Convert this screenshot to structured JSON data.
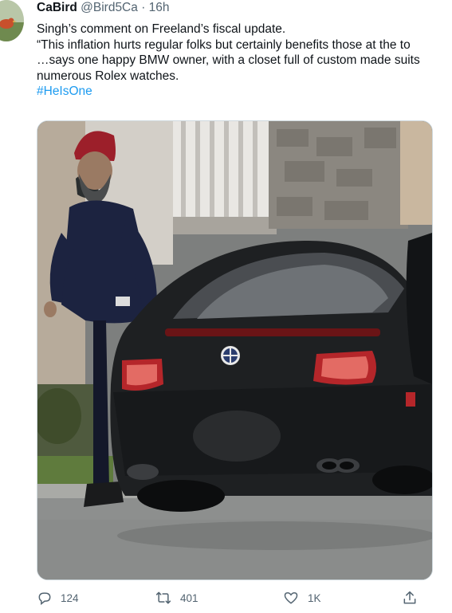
{
  "tweet": {
    "display_name": "CaBird",
    "handle": "@Bird5Ca",
    "separator": "·",
    "time": "16h",
    "lines": [
      "Singh’s comment on Freeland’s fiscal update.",
      "“This inflation hurts regular folks but certainly benefits those at the to",
      "…says one happy BMW owner, with a closet full of custom made suits",
      "numerous Rolex watches."
    ],
    "hashtag": "#HeIsOne"
  },
  "actions": {
    "reply_count": "124",
    "retweet_count": "401",
    "like_count": "1K"
  },
  "colors": {
    "text": "#0f1419",
    "muted": "#536471",
    "link": "#1d9bf0"
  },
  "icons": [
    "reply-icon",
    "retweet-icon",
    "like-icon",
    "share-icon"
  ]
}
